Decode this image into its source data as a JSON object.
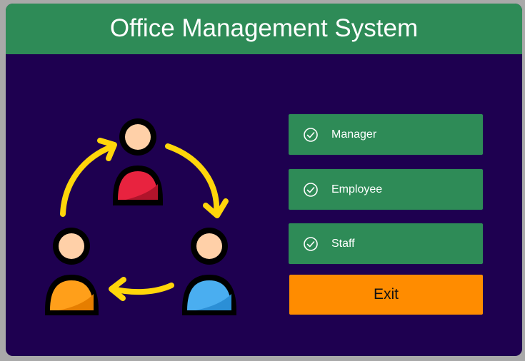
{
  "window": {
    "title": "Office Management System"
  },
  "menu": {
    "items": [
      {
        "label": "Manager",
        "icon": "check-circle-icon"
      },
      {
        "label": "Employee",
        "icon": "check-circle-icon"
      },
      {
        "label": "Staff",
        "icon": "check-circle-icon"
      }
    ],
    "exit_label": "Exit"
  },
  "colors": {
    "background": "#1e0050",
    "header": "#2e8b57",
    "menu_button": "#2e8b57",
    "exit_button": "#ff8c00",
    "arrows": "#ffd60a"
  },
  "illustration": {
    "icon": "team-cycle-icon"
  }
}
